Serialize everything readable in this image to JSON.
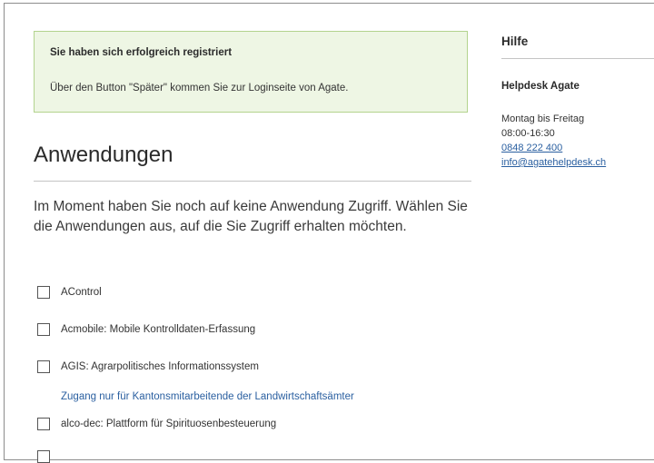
{
  "notice": {
    "title": "Sie haben sich erfolgreich registriert",
    "text": "Über den Button \"Später\" kommen Sie zur Loginseite von Agate."
  },
  "section": {
    "title": "Anwendungen",
    "intro": "Im Moment haben Sie noch auf keine Anwendung Zugriff. Wählen Sie die Anwendungen aus, auf die Sie Zugriff erhalten möchten."
  },
  "applications": [
    {
      "label": "AControl",
      "checked": false
    },
    {
      "label": "Acmobile: Mobile Kontrolldaten-Erfassung",
      "checked": false
    },
    {
      "label": "AGIS: Agrarpolitisches Informationssystem",
      "checked": false,
      "note": "Zugang nur für Kantonsmitarbeitende der Landwirtschaftsämter"
    },
    {
      "label": "alco-dec: Plattform für Spirituosenbesteuerung",
      "checked": false
    }
  ],
  "sidebar": {
    "title": "Hilfe",
    "helpdesk": {
      "title": "Helpdesk Agate",
      "hours_days": "Montag bis Freitag",
      "hours_time": "08:00-16:30",
      "phone": "0848 222 400",
      "email": "info@agatehelpdesk.ch"
    }
  }
}
